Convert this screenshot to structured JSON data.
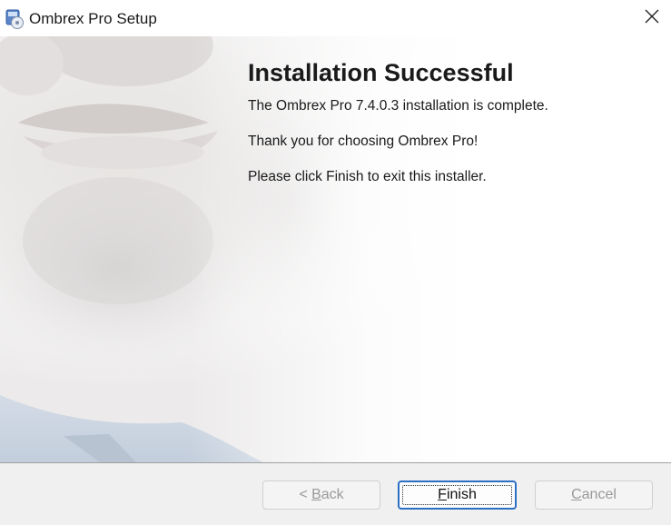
{
  "window": {
    "title": "Ombrex Pro Setup"
  },
  "page": {
    "heading": "Installation Successful",
    "line_complete": "The Ombrex Pro 7.4.0.3 installation is complete.",
    "line_thanks": "Thank you for choosing Ombrex Pro!",
    "line_instruction": "Please click Finish to exit this installer."
  },
  "buttons": {
    "back": {
      "prefix": "< ",
      "accel": "B",
      "rest": "ack",
      "enabled": false
    },
    "finish": {
      "accel": "F",
      "rest": "inish",
      "enabled": true,
      "focused": true
    },
    "cancel": {
      "accel": "C",
      "rest": "ancel",
      "enabled": false
    }
  },
  "icons": {
    "app": "installer-disc-icon",
    "close": "close-icon"
  },
  "colors": {
    "focus_border": "#2a6fc4",
    "footer_bg": "#f0f0f0",
    "disabled_text": "#9a9a9a"
  }
}
